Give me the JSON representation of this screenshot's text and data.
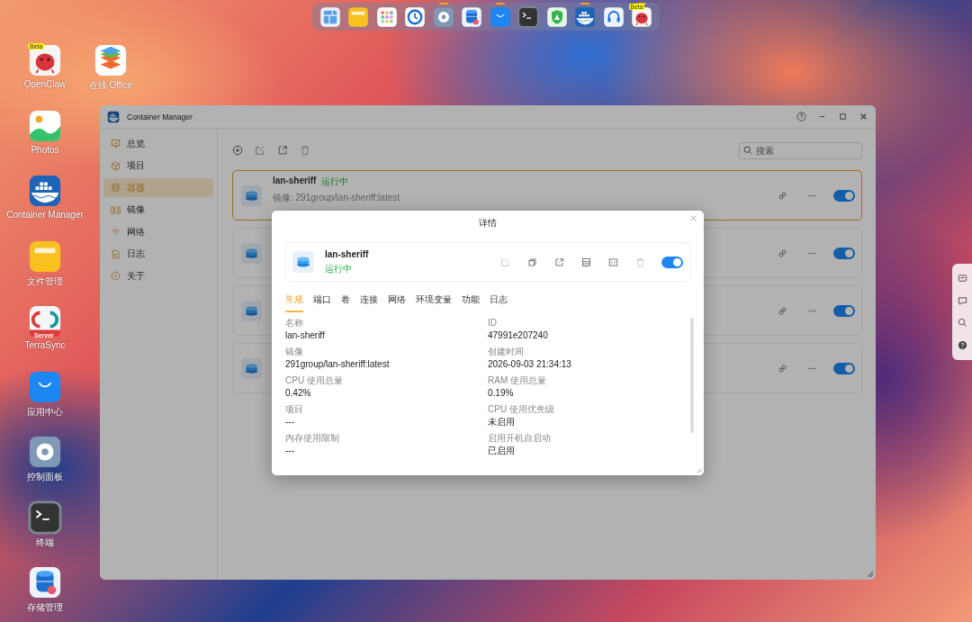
{
  "dock": [
    {
      "kind": "layout",
      "running": false
    },
    {
      "kind": "files",
      "running": false
    },
    {
      "kind": "apps",
      "running": false
    },
    {
      "kind": "clock",
      "running": false
    },
    {
      "kind": "settings",
      "running": true
    },
    {
      "kind": "storage",
      "running": false
    },
    {
      "kind": "appstore",
      "running": true
    },
    {
      "kind": "terminal",
      "running": false
    },
    {
      "kind": "shield",
      "running": false
    },
    {
      "kind": "docker",
      "running": true
    },
    {
      "kind": "headset",
      "running": false
    },
    {
      "kind": "openclaw",
      "running": true,
      "badge": "Beta"
    }
  ],
  "desktop_icons": [
    {
      "kind": "openclaw",
      "label": "OpenClaw",
      "badge": "Beta"
    },
    {
      "kind": "office",
      "label": "在线 Office"
    },
    {
      "kind": "photos",
      "label": "Photos"
    },
    {
      "kind": "docker",
      "label": "Container Manager"
    },
    {
      "kind": "files",
      "label": "文件管理"
    },
    {
      "kind": "terrasync",
      "label": "TerraSync",
      "badge": "Server"
    },
    {
      "kind": "appstore",
      "label": "应用中心"
    },
    {
      "kind": "settings",
      "label": "控制面板"
    },
    {
      "kind": "terminal",
      "label": "终端"
    },
    {
      "kind": "storage",
      "label": "存储管理"
    }
  ],
  "window": {
    "title": "Container Manager",
    "sidebar": [
      {
        "kind": "overview",
        "label": "总览",
        "selected": false
      },
      {
        "kind": "project",
        "label": "项目",
        "selected": false
      },
      {
        "kind": "container",
        "label": "容器",
        "selected": true
      },
      {
        "kind": "image",
        "label": "镜像",
        "selected": false
      },
      {
        "kind": "network",
        "label": "网络",
        "selected": false
      },
      {
        "kind": "log",
        "label": "日志",
        "selected": false
      },
      {
        "kind": "about",
        "label": "关于",
        "selected": false
      }
    ],
    "search": {
      "placeholder": "搜索"
    },
    "containers": [
      {
        "name": "lan-sheriff",
        "status": "运行中",
        "image": "镜像: 291group/lan-sheriff:latest",
        "on": true,
        "selected": true
      },
      {
        "on": true,
        "selected": false
      },
      {
        "on": true,
        "selected": false
      },
      {
        "on": true,
        "selected": false
      }
    ]
  },
  "dialog": {
    "title": "详情",
    "container": {
      "name": "lan-sheriff",
      "status": "运行中",
      "on": true
    },
    "tabs": [
      {
        "label": "常规",
        "selected": true
      },
      {
        "label": "端口",
        "selected": false
      },
      {
        "label": "卷",
        "selected": false
      },
      {
        "label": "连接",
        "selected": false
      },
      {
        "label": "网络",
        "selected": false
      },
      {
        "label": "环境变量",
        "selected": false
      },
      {
        "label": "功能",
        "selected": false
      },
      {
        "label": "日志",
        "selected": false
      }
    ],
    "fields": [
      {
        "label": "名称",
        "value": "lan-sheriff"
      },
      {
        "label": "ID",
        "value": "47991e207240"
      },
      {
        "label": "镜像",
        "value": "291group/lan-sheriff:latest"
      },
      {
        "label": "创建时间",
        "value": "2026-09-03 21:34:13"
      },
      {
        "label": "CPU 使用总量",
        "value": "0.42%"
      },
      {
        "label": "RAM 使用总量",
        "value": "0.19%"
      },
      {
        "label": "项目",
        "value": "---"
      },
      {
        "label": "CPU 使用优先级",
        "value": "未启用"
      },
      {
        "label": "内存使用限制",
        "value": "---"
      },
      {
        "label": "启用开机自启动",
        "value": "已启用"
      }
    ]
  }
}
